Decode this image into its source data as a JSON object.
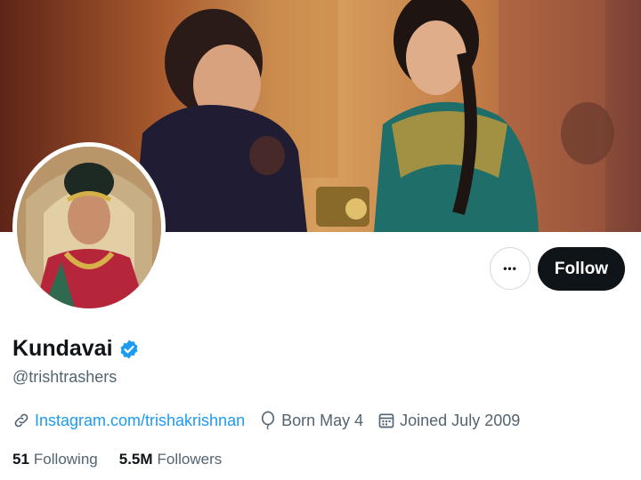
{
  "profile": {
    "name": "Kundavai",
    "handle": "@trishtrashers",
    "verified": true,
    "link_text": "Instagram.com/trishakrishnan",
    "born": "Born May 4",
    "joined": "Joined July 2009"
  },
  "stats": {
    "following_count": "51",
    "following_label": "Following",
    "followers_count": "5.5M",
    "followers_label": "Followers"
  },
  "actions": {
    "more_label": "•••",
    "follow_label": "Follow"
  },
  "colors": {
    "link": "#1d9bf0",
    "verified": "#1d9bf0",
    "follow_bg": "#0f1419",
    "secondary_text": "#536471"
  },
  "icons": {
    "link": "link-icon",
    "born": "balloon-icon",
    "joined": "calendar-icon",
    "verified": "verified-badge-icon",
    "more": "more-icon"
  }
}
